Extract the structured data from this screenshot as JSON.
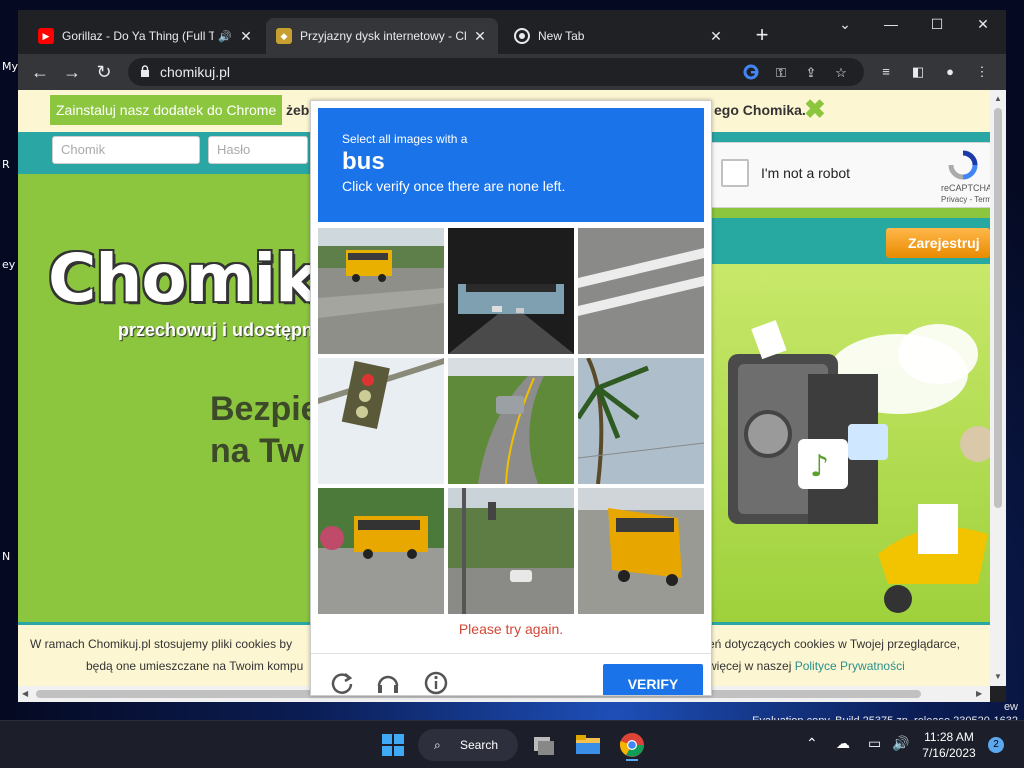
{
  "desktop": {
    "icon_labels": [
      "My",
      "R",
      "ey",
      "N"
    ],
    "watermark_line1": "ew",
    "watermark_line2": "Evaluation copy. Build 25375.zn_release.230520-1632"
  },
  "browser": {
    "tabs": [
      {
        "title": "Gorillaz - Do Ya Thing (Full T",
        "favicon": "youtube-icon",
        "audio": true
      },
      {
        "title": "Przyjazny dysk internetowy - Cho",
        "favicon": "chomikuj-icon",
        "active": true
      },
      {
        "title": "New Tab",
        "favicon": "chrome-icon"
      }
    ],
    "url": "chomikuj.pl"
  },
  "page": {
    "promo_button": "Zainstaluj nasz dodatek do Chrome",
    "promo_text_left": "żeb",
    "promo_text_right": "ego Chomika.",
    "login_placeholder": "Chomik",
    "password_placeholder": "Hasło",
    "register_button": "Zarejestruj",
    "logo": "Chomikuj.",
    "tagline": "przechowuj i udostępni",
    "headline_line1": "Bezpie",
    "headline_line2": "na Tw",
    "cookie_l1": "W ramach Chomikuj.pl stosujemy pliki cookies by",
    "cookie_l2": "będą one umieszczane na Twoim kompu",
    "cookie_r1": "eń dotyczących cookies w Twojej przeglądarce,",
    "cookie_r2_prefix": "więcej w naszej ",
    "cookie_r2_link": "Polityce Prywatności"
  },
  "recaptcha": {
    "checkbox_label": "I'm not a robot",
    "brand": "reCAPTCHA",
    "terms": "Privacy - Terms"
  },
  "challenge": {
    "instruction": "Select all images with a",
    "target": "bus",
    "sub_instruction": "Click verify once there are none left.",
    "error": "Please try again.",
    "verify_button": "VERIFY",
    "tiles": [
      "school bus on road intersection",
      "highway underpass",
      "road lane markings",
      "traffic light",
      "car on winding road",
      "palm tree",
      "school bus near trees",
      "street with traffic light and car",
      "school bus rear view"
    ]
  },
  "taskbar": {
    "search_label": "Search",
    "time": "11:28 AM",
    "date": "7/16/2023",
    "notification_count": "2"
  }
}
